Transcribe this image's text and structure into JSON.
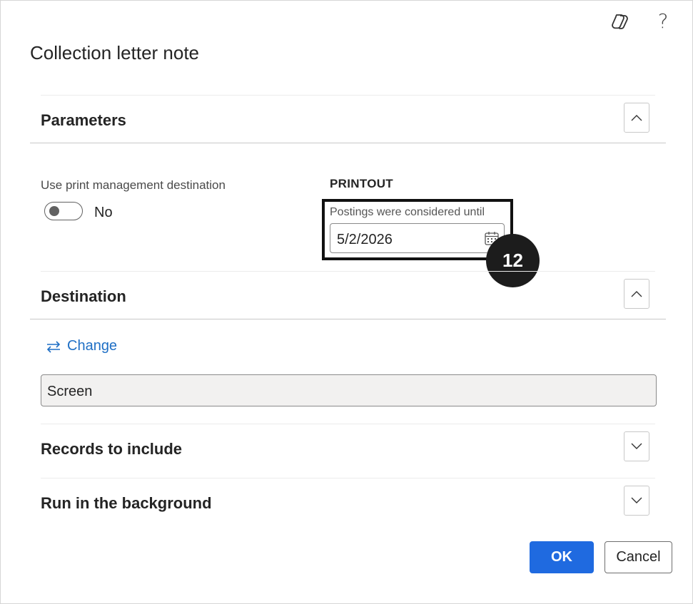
{
  "dialog": {
    "title": "Collection letter note",
    "icons": [
      "copilot-icon",
      "help-icon"
    ],
    "help_glyph": "?"
  },
  "parameters": {
    "section_title": "Parameters",
    "use_print_mgmt_label": "Use print management destination",
    "use_print_mgmt_value": "No",
    "printout_heading": "PRINTOUT",
    "postings_label": "Postings were considered until",
    "postings_value": "5/2/2026",
    "step_badge": "12"
  },
  "destination": {
    "section_title": "Destination",
    "change_label": "Change",
    "destination_value": "Screen"
  },
  "records": {
    "section_title": "Records to include"
  },
  "background": {
    "section_title": "Run in the background"
  },
  "footer": {
    "ok_label": "OK",
    "cancel_label": "Cancel"
  },
  "colors": {
    "accent": "#1f6ae0",
    "link": "#1f6fc5",
    "badge": "#1c1c1c"
  }
}
